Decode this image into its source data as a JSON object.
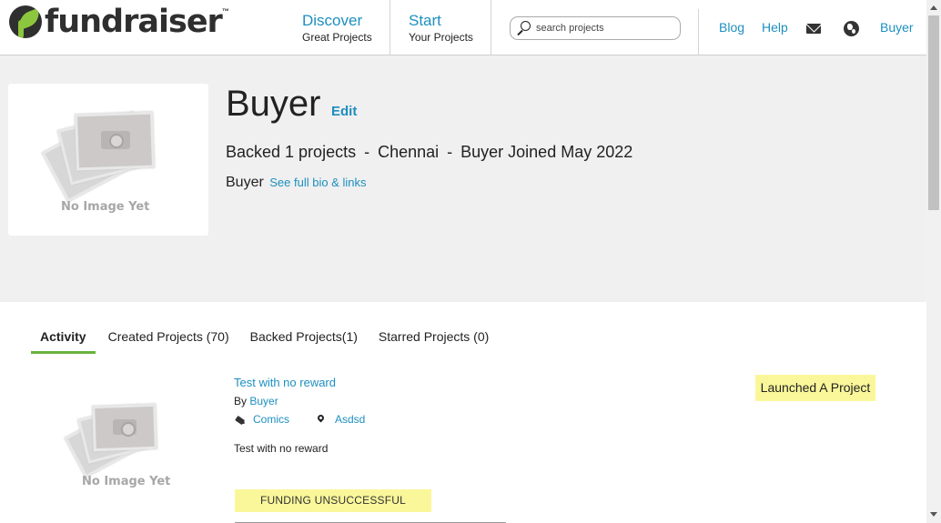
{
  "header": {
    "logo_text": "fundraiser",
    "logo_tm": "™",
    "discover": {
      "big": "Discover",
      "small": "Great Projects"
    },
    "start": {
      "big": "Start",
      "small": "Your Projects"
    },
    "search_placeholder": "search projects",
    "links": {
      "blog": "Blog",
      "help": "Help",
      "user": "Buyer"
    }
  },
  "profile": {
    "image_caption": "No Image Yet",
    "name": "Buyer",
    "edit_label": "Edit",
    "stats": {
      "backed": "Backed 1 projects",
      "location": "Chennai",
      "joined": "Buyer Joined May 2022"
    },
    "bio_text": "Buyer",
    "bio_link": "See full bio & links"
  },
  "tabs": [
    {
      "label": "Activity"
    },
    {
      "label": "Created Projects (70)"
    },
    {
      "label": "Backed Projects(1)"
    },
    {
      "label": "Starred Projects (0)"
    }
  ],
  "activity": {
    "image_caption": "No Image Yet",
    "title": "Test with no reward",
    "by_prefix": "By",
    "by_user": "Buyer",
    "category": "Comics",
    "location": "Asdsd",
    "description": "Test with no reward",
    "status": "FUNDING UNSUCCESSFUL",
    "event": "Launched A Project"
  }
}
